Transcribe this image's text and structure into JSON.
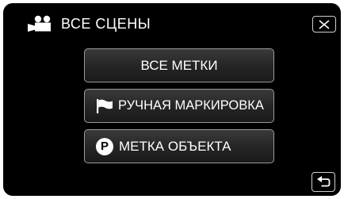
{
  "header": {
    "icon": "video-camera-icon",
    "title": "ВСЕ СЦЕНЫ"
  },
  "close_button": {
    "icon": "close-icon"
  },
  "menu": {
    "items": [
      {
        "label": "ВСЕ МЕТКИ"
      },
      {
        "label": "РУЧНАЯ МАРКИРОВКА",
        "icon": "flag-icon"
      },
      {
        "label": "МЕТКА ОБЪЕКТА",
        "icon": "p-circle-icon",
        "icon_letter": "P"
      }
    ]
  },
  "back_button": {
    "icon": "return-arrow-icon"
  },
  "colors": {
    "background": "#000000",
    "text": "#ffffff",
    "button_border": "#9a9a9a"
  }
}
